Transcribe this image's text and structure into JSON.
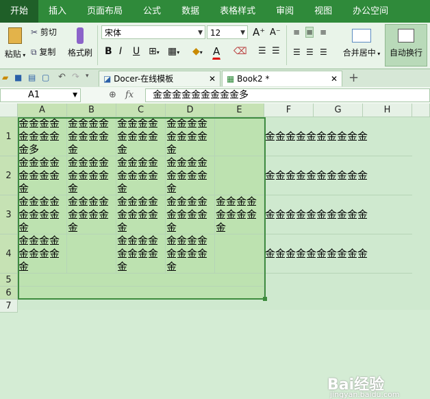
{
  "menu": [
    "开始",
    "插入",
    "页面布局",
    "公式",
    "数据",
    "表格样式",
    "审阅",
    "视图",
    "办公空间"
  ],
  "ribbon": {
    "paste": "粘贴",
    "cut": "剪切",
    "copy": "复制",
    "format_painter": "格式刷",
    "font_name": "宋体",
    "font_size": "12",
    "merge_center": "合并居中",
    "wrap_text": "自动换行"
  },
  "tabs": [
    {
      "label": "Docer-在线模板"
    },
    {
      "label": "Book2 *"
    }
  ],
  "formula_bar": {
    "cell_ref": "A1",
    "fx": "fx",
    "content": "金金金金金金金金金多"
  },
  "columns": [
    "A",
    "B",
    "C",
    "D",
    "E",
    "F",
    "G",
    "H"
  ],
  "rows": [
    "1",
    "2",
    "3",
    "4",
    "5",
    "6",
    "7"
  ],
  "cells": {
    "A1": "金金金金金金金金金多",
    "B1": "金金金金金金金金金",
    "C1": "金金金金金金金金金",
    "D1": "金金金金金金金金金",
    "F1": "金金金金金金金金金金",
    "A2": "金金金金金金金金金",
    "B2": "金金金金金金金金金",
    "C2": "金金金金金金金金金",
    "D2": "金金金金金金金金金",
    "F2": "金金金金金金金金金金",
    "A3": "金金金金金金金金金",
    "B3": "金金金金金金金金金",
    "C3": "金金金金金金金金金",
    "D3": "金金金金金金金金金",
    "E3": "金金金金金金金金金",
    "F3": "金金金金金金金金金金",
    "A4": "金金金金金金金金金",
    "C4": "金金金金金金金金金",
    "D4": "金金金金金金金金金",
    "F4": "金金金金金金金金金金"
  },
  "watermark": {
    "brand": "Bai经验",
    "url": "jingyan.baidu.com"
  }
}
